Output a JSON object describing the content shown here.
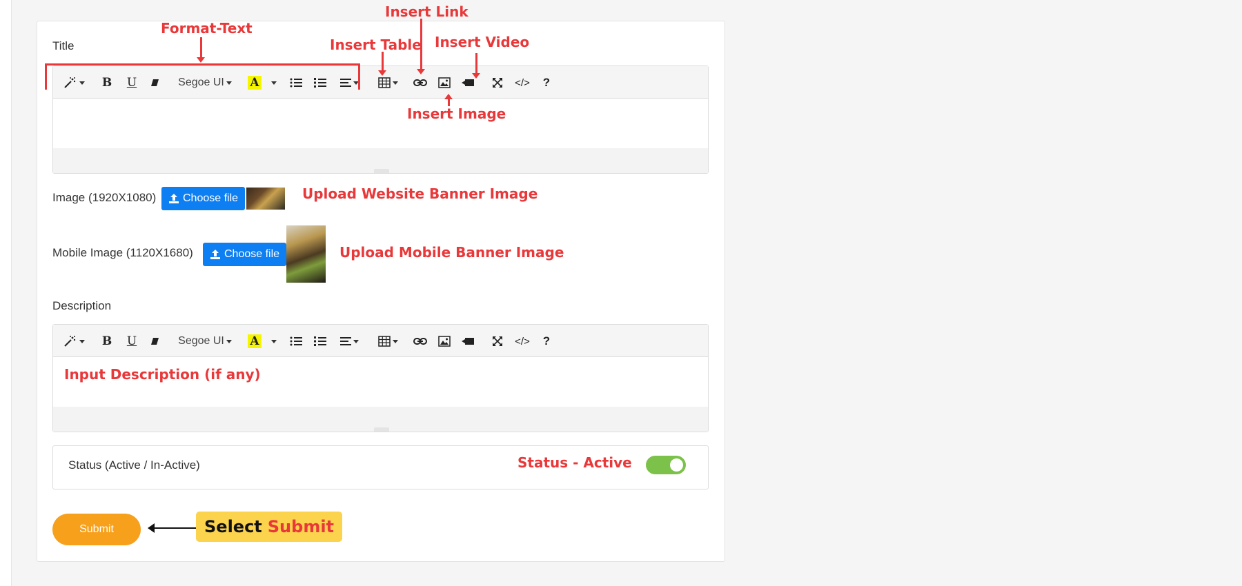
{
  "form": {
    "title_label": "Title",
    "image_label": "Image (1920X1080)",
    "mobile_image_label": "Mobile Image (1120X1680)",
    "choose_file_label": "Choose file",
    "description_label": "Description",
    "status_label": "Status (Active / In-Active)",
    "status_active": true,
    "submit_label": "Submit"
  },
  "toolbar": {
    "font_name": "Segoe UI",
    "buttons": [
      "magic",
      "bold",
      "underline",
      "eraser",
      "font",
      "color",
      "color-dropdown",
      "unordered-list",
      "ordered-list",
      "align",
      "table",
      "link",
      "picture",
      "video",
      "fullscreen",
      "code-view",
      "help"
    ]
  },
  "annotations": {
    "format_text": "Format-Text",
    "insert_link": "Insert Link",
    "insert_table": "Insert Table",
    "insert_video": "Insert Video",
    "insert_image": "Insert Image",
    "upload_website": "Upload Website Banner Image",
    "upload_mobile": "Upload Mobile Banner Image",
    "input_description": "Input Description (if any)",
    "status_active": "Status - Active",
    "select": "Select",
    "submit": "Submit"
  },
  "colors": {
    "annotation": "#e8383a",
    "upload_button": "#0d7ff2",
    "submit_button": "#f6a01c",
    "toggle_on": "#7cc24a",
    "callout": "#fcd34d"
  }
}
